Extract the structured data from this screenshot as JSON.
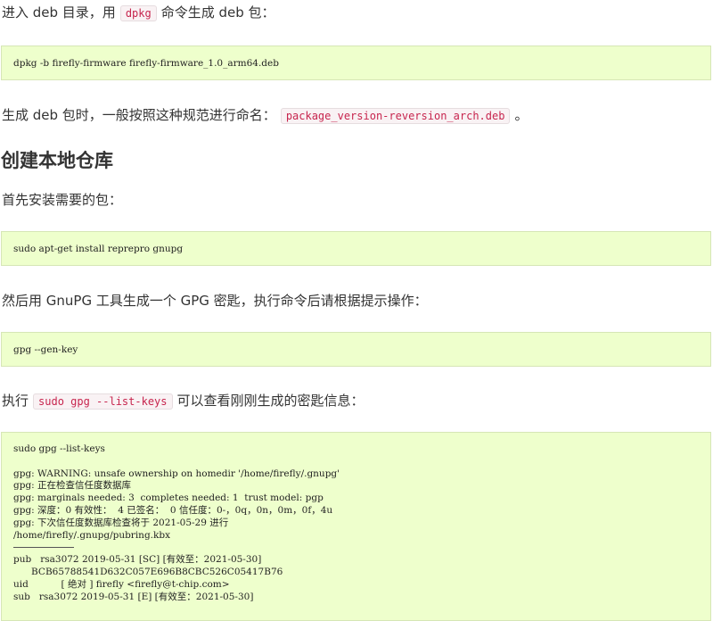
{
  "p1": {
    "before": "进入 deb 目录，用",
    "code": "dpkg",
    "after": "命令生成 deb 包："
  },
  "code1": "dpkg -b firefly-firmware firefly-firmware_1.0_arm64.deb",
  "p2": {
    "before": "生成 deb 包时，一般按照这种规范进行命名：",
    "code": "package_version-reversion_arch.deb",
    "after": "。"
  },
  "heading": "创建本地仓库",
  "p3": "首先安装需要的包：",
  "code2": "sudo apt-get install reprepro gnupg",
  "p4": "然后用 GnuPG 工具生成一个 GPG 密匙，执行命令后请根据提示操作：",
  "code3": "gpg --gen-key",
  "p5": {
    "before": "执行",
    "code": "sudo gpg --list-keys",
    "after": "可以查看刚刚生成的密匙信息："
  },
  "code4": {
    "lines_a": [
      "sudo gpg --list-keys",
      "",
      "gpg: WARNING: unsafe ownership on homedir '/home/firefly/.gnupg'",
      "gpg: 正在检查信任度数据库",
      "gpg: marginals needed: 3  completes needed: 1  trust model: pgp",
      "gpg: 深度：0 有效性：  4 已签名：  0 信任度：0-，0q，0n，0m，0f，4u",
      "gpg: 下次信任度数据库检查将于 2021-05-29 进行",
      "/home/firefly/.gnupg/pubring.kbx"
    ],
    "lines_b": [
      "pub   rsa3072 2019-05-31 [SC] [有效至：2021-05-30]",
      "      BCB65788541D632C057E696B8CBC526C05417B76",
      "uid           [ 绝对 ] firefly <firefly@t-chip.com>",
      "sub   rsa3072 2019-05-31 [E] [有效至：2021-05-30]"
    ]
  }
}
